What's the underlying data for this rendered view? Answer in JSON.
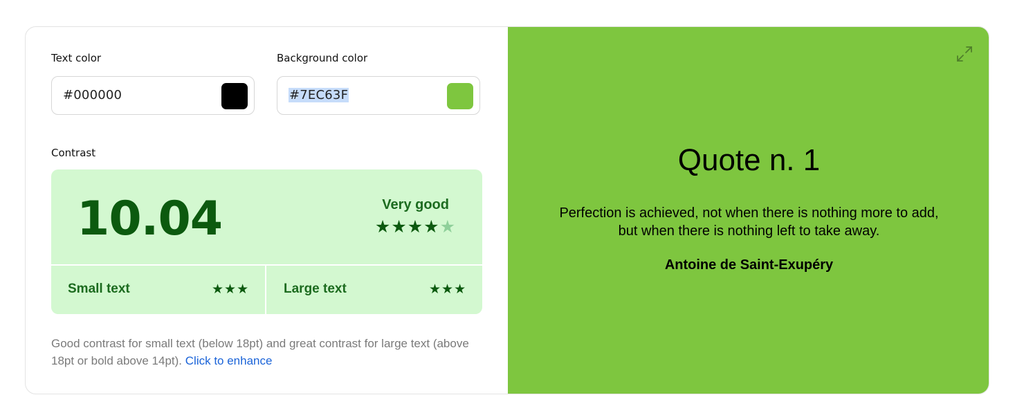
{
  "inputs": {
    "text_color_label": "Text color",
    "text_color_value": "#000000",
    "text_color_swatch": "#000000",
    "background_color_label": "Background color",
    "background_color_value": "#7EC63F",
    "background_color_swatch": "#7EC63F"
  },
  "contrast": {
    "label": "Contrast",
    "ratio": "10.04",
    "rating": "Very good",
    "rating_stars_filled": 4,
    "rating_stars_total": 5,
    "rating_stars_filled_text": "★★★★",
    "rating_stars_empty_text": "★",
    "small_text_label": "Small text",
    "small_text_stars": "★★★",
    "large_text_label": "Large text",
    "large_text_stars": "★★★"
  },
  "description": {
    "text": "Good contrast for small text (below 18pt) and great contrast for large text (above 18pt or bold above 14pt).",
    "link": "Click to enhance"
  },
  "preview": {
    "title": "Quote n. 1",
    "quote": "Perfection is achieved, not when there is nothing more to add, but when there is nothing left to take away.",
    "author": "Antoine de Saint-Exupéry",
    "expand_icon": "expand-icon"
  },
  "colors": {
    "contrast_bg": "#d3f8d0",
    "contrast_fg": "#0c5a0f",
    "link": "#1a63d8",
    "selection": "#c6dcfa"
  }
}
